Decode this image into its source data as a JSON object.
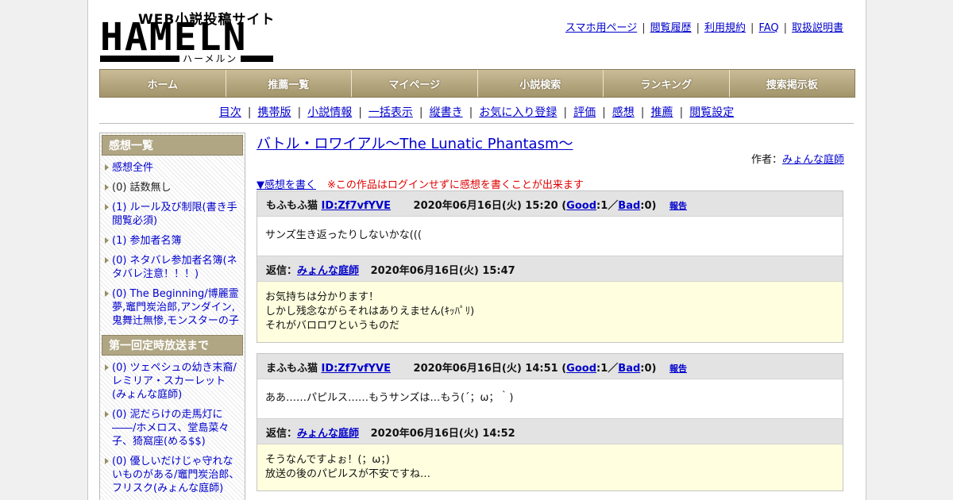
{
  "logo": {
    "tagline": "WEB小説投稿サイト",
    "name": "HAMELN",
    "kana": "ハーメルン"
  },
  "top_links": [
    "スマホ用ページ",
    "閲覧履歴",
    "利用規約",
    "FAQ",
    "取扱説明書"
  ],
  "main_nav": [
    "ホーム",
    "推薦一覧",
    "マイページ",
    "小説検索",
    "ランキング",
    "捜索掲示板"
  ],
  "sub_nav": [
    "目次",
    "携帯版",
    "小説情報",
    "一括表示",
    "縦書き",
    "お気に入り登録",
    "評価",
    "感想",
    "推薦",
    "閲覧設定"
  ],
  "sidebar": {
    "section1_title": "感想一覧",
    "section1_items": [
      {
        "text": "感想全件",
        "link": true
      },
      {
        "text": "(0) 話数無し",
        "link": false
      },
      {
        "text": "(1) ルール及び制限(書き手閲覧必須)",
        "link": true
      },
      {
        "text": "(1) 参加者名簿",
        "link": true
      },
      {
        "text": "(0) ネタバレ参加者名簿(ネタバレ注意！！！)",
        "link": true
      },
      {
        "text": "(0) The Beginning/博麗霊夢,竈門炭治郎,アンダイン,鬼舞辻無惨,モンスターの子",
        "link": true
      }
    ],
    "section2_title": "第一回定時放送まで",
    "section2_items": [
      {
        "text": "(0) ツェペシュの幼き末裔/レミリア・スカーレット(みょんな庭師)",
        "link": true
      },
      {
        "text": "(0) 泥だらけの走馬灯に――/ホメロス、堂島菜々子、猗窩座(める$$)",
        "link": true
      },
      {
        "text": "(0) 優しいだけじゃ守れないものがある/竈門炭治郎、フリスク(みょんな庭師)",
        "link": true
      }
    ]
  },
  "main": {
    "title": "バトル・ロワイアル～The Lunatic Phantasm～",
    "author_label": "作者：",
    "author": "みょんな庭師",
    "write_link": "▼感想を書く",
    "login_note": "※この作品はログインせずに感想を書くことが出来ます",
    "comments": [
      {
        "user": "もふもふ猫",
        "id": "ID:Zf7vfYVE",
        "date": "2020年06月16日(火) 15:20",
        "good_label": "Good",
        "good": ":1",
        "sep": "／",
        "bad_label": "Bad",
        "bad": ":0",
        "report": "報告",
        "body": "サンズ生き返ったりしないかな(((",
        "reply_label": "返信：",
        "reply_author": "みょんな庭師",
        "reply_date": "2020年06月16日(火) 15:47",
        "reply_lines": [
          "お気持ちは分かります！",
          "しかし残念ながらそれはありえません(ｷｯﾊﾟﾘ)",
          "それがバロロワというものだ"
        ]
      },
      {
        "user": "まふもふ猫",
        "id": "ID:Zf7vfYVE",
        "date": "2020年06月16日(火) 14:51",
        "good_label": "Good",
        "good": ":1",
        "sep": "／",
        "bad_label": "Bad",
        "bad": ":0",
        "report": "報告",
        "body": "ああ……パピルス……もうサンズは…もう(´；ω；｀)",
        "reply_label": "返信：",
        "reply_author": "みょんな庭師",
        "reply_date": "2020年06月16日(火) 14:52",
        "reply_lines": [
          "そうなんですよぉ！(；ω；)",
          "放送の後のパピルスが不安ですね…"
        ]
      }
    ]
  }
}
